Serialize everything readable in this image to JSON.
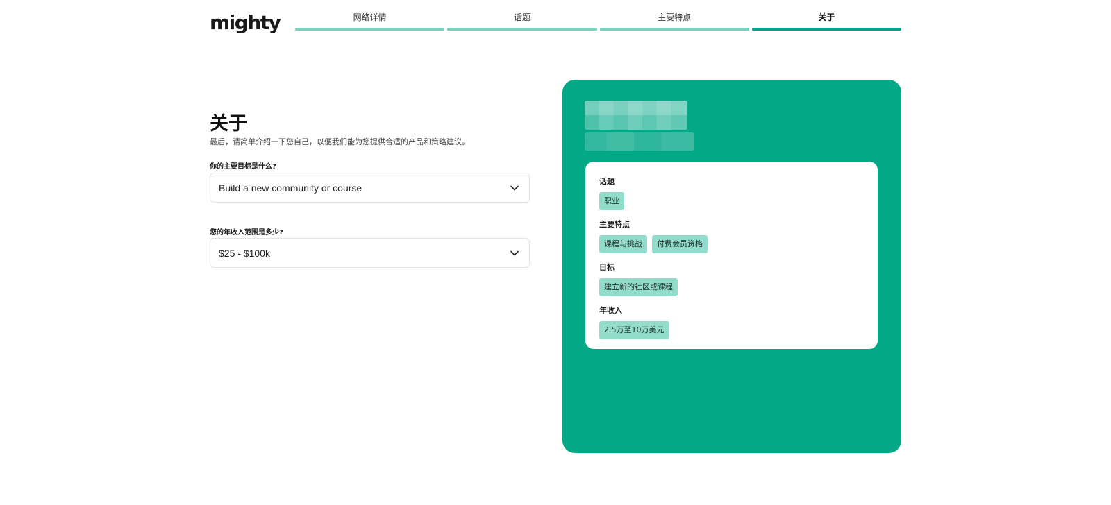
{
  "brand": {
    "logo_text": "mighty"
  },
  "steps": [
    {
      "label": "网络详情",
      "active": false
    },
    {
      "label": "话题",
      "active": false
    },
    {
      "label": "主要特点",
      "active": false
    },
    {
      "label": "关于",
      "active": true
    }
  ],
  "form": {
    "title": "关于",
    "description": "最后，请简单介绍一下您自己，以便我们能为您提供合适的产品和策略建议。",
    "goal": {
      "label": "你的主要目标是什么?",
      "value": "Build a new community or course"
    },
    "revenue": {
      "label": "您的年收入范围是多少?",
      "value": "$25 - $100k"
    }
  },
  "summary": {
    "topics": {
      "label": "话题",
      "tags": [
        "职业"
      ]
    },
    "features": {
      "label": "主要特点",
      "tags": [
        "课程与挑战",
        "付费会员资格"
      ]
    },
    "goal": {
      "label": "目标",
      "tags": [
        "建立新的社区或课程"
      ]
    },
    "revenue": {
      "label": "年收入",
      "tags": [
        "2.5万至10万美元"
      ]
    }
  },
  "colors": {
    "accent": "#03a887",
    "accent_light": "#7fcfbd",
    "tag_bg": "#92dccb"
  },
  "icons": {
    "select_chevron": "chevron-down-icon"
  }
}
